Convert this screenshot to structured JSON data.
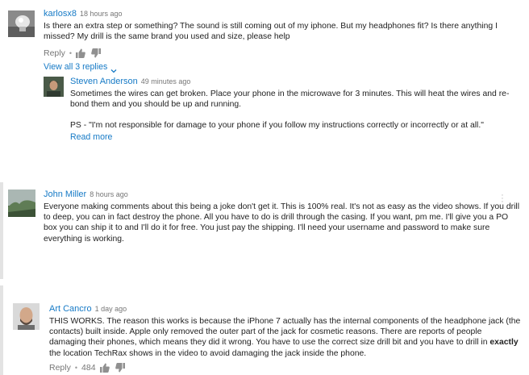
{
  "comments": [
    {
      "author": "karlosx8",
      "time": "18 hours ago",
      "lines": [
        "Is there an extra step or something? The sound is still coming out of my iphone. But my headphones fit? Is there anything I",
        "missed? My drill is the same brand you used and size, please help"
      ],
      "reply_label": "Reply",
      "view_replies": "View all 3 replies",
      "avatar_icon": "lightbulb-photo-avatar"
    },
    {
      "author": "Steven Anderson",
      "time": "49 minutes ago",
      "lines": [
        "Sometimes the wires can get broken. Place your phone in the microwave for 3 minutes. This will heat the wires and re-",
        "bond them and you should be up and running."
      ],
      "ps": "PS - \"I'm not responsible for damage to your phone if you follow my instructions correctly or incorrectly or at all.\"",
      "read_more": "Read more",
      "avatar_icon": "man-portrait-avatar"
    },
    {
      "author": "John Miller",
      "time": "8 hours ago",
      "lines": [
        "Everyone making comments about this being a joke don't get it. This is 100% real. It's not as easy as the video shows. If you drill",
        "to deep, you can in fact destroy the phone. All you have to do is drill through the casing. If you want, pm me. I'll give you a PO",
        "box you can ship it to and I'll do it for free. You just pay the shipping. I'll need your username and password to make sure",
        "everything is working."
      ],
      "avatar_icon": "landscape-photo-avatar"
    },
    {
      "author": "Art Cancro",
      "time": "1 day ago",
      "lines": [
        "THIS WORKS.  The reason this works is because the iPhone 7 actually has the internal components of the headphone jack (the",
        "contacts) built inside.  Apple only removed the outer part of the jack for cosmetic reasons.  There are reports of people",
        "damaging their phones, which means they did it wrong.  You have to use the correct size drill bit and you have to drill in"
      ],
      "line4_before": " ",
      "line4_bold": "exactly",
      "line5": "the location TechRax shows in the video to avoid damaging the jack inside the phone.",
      "reply_label": "Reply",
      "like_count": "484",
      "avatar_icon": "bald-man-portrait-avatar"
    }
  ],
  "colors": {
    "author_link": "#167ac6",
    "meta_gray": "#767676",
    "body_text": "#222222"
  },
  "icons": {
    "like": "thumbs-up-icon",
    "dislike": "thumbs-down-icon",
    "chevron": "chevron-down-icon",
    "more": "more-vertical-icon"
  }
}
